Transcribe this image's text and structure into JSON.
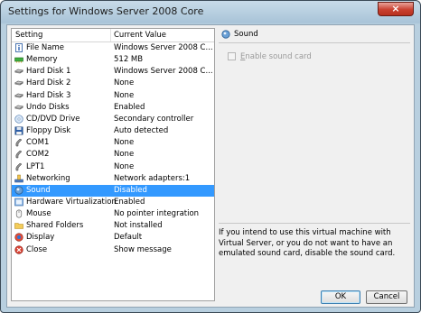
{
  "window": {
    "title": "Settings for Windows Server 2008 Core",
    "close_label": "×"
  },
  "settings_list": {
    "column_setting": "Setting",
    "column_value": "Current Value",
    "rows": [
      {
        "name": "File Name",
        "value": "Windows Server 2008 C...",
        "icon": "file-info-icon"
      },
      {
        "name": "Memory",
        "value": "512 MB",
        "icon": "memory-icon"
      },
      {
        "name": "Hard Disk 1",
        "value": "Windows Server 2008 C...",
        "icon": "hard-disk-icon"
      },
      {
        "name": "Hard Disk 2",
        "value": "None",
        "icon": "hard-disk-icon"
      },
      {
        "name": "Hard Disk 3",
        "value": "None",
        "icon": "hard-disk-icon"
      },
      {
        "name": "Undo Disks",
        "value": "Enabled",
        "icon": "undo-disks-icon"
      },
      {
        "name": "CD/DVD Drive",
        "value": "Secondary controller",
        "icon": "cd-dvd-icon"
      },
      {
        "name": "Floppy Disk",
        "value": "Auto detected",
        "icon": "floppy-icon"
      },
      {
        "name": "COM1",
        "value": "None",
        "icon": "serial-port-icon"
      },
      {
        "name": "COM2",
        "value": "None",
        "icon": "serial-port-icon"
      },
      {
        "name": "LPT1",
        "value": "None",
        "icon": "parallel-port-icon"
      },
      {
        "name": "Networking",
        "value": "Network adapters:1",
        "icon": "network-icon"
      },
      {
        "name": "Sound",
        "value": "Disabled",
        "icon": "sound-icon",
        "selected": true
      },
      {
        "name": "Hardware Virtualization",
        "value": "Enabled",
        "icon": "hardware-virtualization-icon"
      },
      {
        "name": "Mouse",
        "value": "No pointer integration",
        "icon": "mouse-icon"
      },
      {
        "name": "Shared Folders",
        "value": "Not installed",
        "icon": "folder-icon"
      },
      {
        "name": "Display",
        "value": "Default",
        "icon": "display-icon"
      },
      {
        "name": "Close",
        "value": "Show message",
        "icon": "close-setting-icon"
      }
    ]
  },
  "sound_panel": {
    "title": "Sound",
    "enable_label_prefix": "",
    "enable_label_accel": "E",
    "enable_label_rest": "nable sound card",
    "enable_checked": false,
    "description": "If you intend to use this virtual machine with Virtual Server, or you do not want to have an emulated sound card, disable the sound card."
  },
  "buttons": {
    "ok": "OK",
    "cancel": "Cancel"
  },
  "colors": {
    "selection": "#3399ff",
    "title_close": "#c9402f"
  }
}
